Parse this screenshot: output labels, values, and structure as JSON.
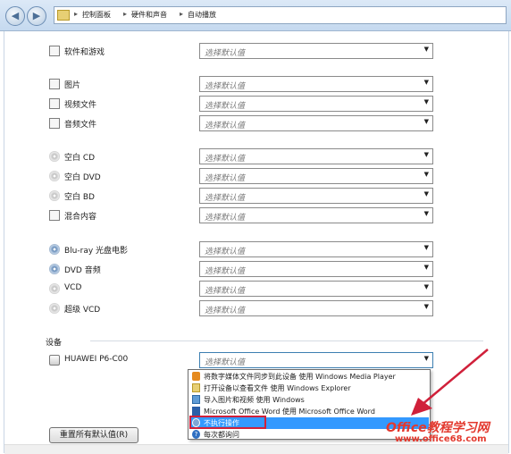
{
  "breadcrumb": {
    "items": [
      "控制面板",
      "硬件和声音",
      "自动播放"
    ]
  },
  "default_select": "选择默认值",
  "rows": [
    {
      "label": "软件和游戏",
      "icon": "software-icon"
    },
    {
      "label": "图片",
      "icon": "picture-icon"
    },
    {
      "label": "视频文件",
      "icon": "video-file-icon"
    },
    {
      "label": "音频文件",
      "icon": "audio-file-icon"
    },
    {
      "label": "空白 CD",
      "icon": "cd-icon"
    },
    {
      "label": "空白 DVD",
      "icon": "dvd-icon"
    },
    {
      "label": "空白 BD",
      "icon": "bd-icon"
    },
    {
      "label": "混合内容",
      "icon": "mixed-content-icon"
    },
    {
      "label": "Blu-ray 光盘电影",
      "icon": "bluray-icon"
    },
    {
      "label": "DVD 音频",
      "icon": "dvd-audio-icon"
    },
    {
      "label": "VCD",
      "icon": "vcd-icon"
    },
    {
      "label": "超级 VCD",
      "icon": "svcd-icon"
    }
  ],
  "devices": {
    "label": "设备",
    "items": [
      {
        "label": "HUAWEI P6-C00",
        "icon": "phone-icon"
      }
    ]
  },
  "dropdown_options": [
    {
      "label": "将数字媒体文件同步到此设备 使用 Windows Media Player",
      "icon": "media-player-icon"
    },
    {
      "label": "打开设备以查看文件 使用 Windows Explorer",
      "icon": "explorer-folder-icon"
    },
    {
      "label": "导入图片和视频 使用 Windows",
      "icon": "import-pictures-icon"
    },
    {
      "label": "Microsoft Office Word 使用 Microsoft Office Word",
      "icon": "word-icon"
    },
    {
      "label": "不执行操作",
      "icon": "no-action-icon",
      "selected": true
    },
    {
      "label": "每次都询问",
      "icon": "help-icon"
    }
  ],
  "reset_button": "重置所有默认值(R)",
  "watermark": {
    "line1": "Office教程学习网",
    "line2": "www.office68.com"
  },
  "colors": {
    "selection": "#3399ff",
    "highlight_border": "#d0203a",
    "watermark": "#e3392e"
  }
}
